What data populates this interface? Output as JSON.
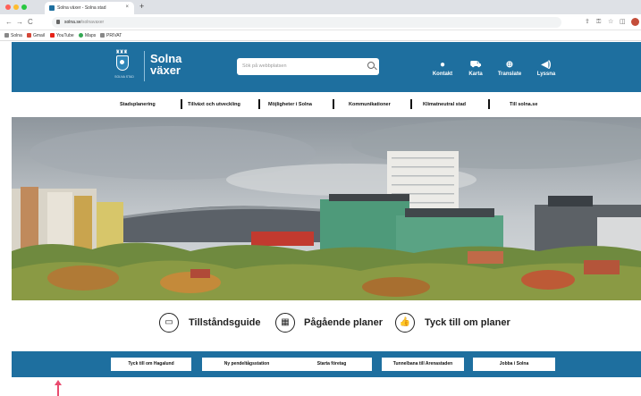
{
  "browser": {
    "tab_title": "Solna växer - Solna stad",
    "tab_close": "×",
    "new_tab": "+",
    "url_host": "solna.se",
    "url_path": "/solnavaxer",
    "nav_back": "←",
    "nav_forward": "→",
    "nav_reload": "C",
    "bookmarks": [
      "Solna",
      "Gmail",
      "YouTube",
      "Maps",
      "PRIVAT"
    ]
  },
  "header": {
    "logo_line1": "Solna",
    "logo_line2": "växer",
    "logo_sub": "SOLNA STAD",
    "search_placeholder": "Sök på webbplatsen",
    "buttons": [
      {
        "label": "Kontakt",
        "icon": "chat-icon"
      },
      {
        "label": "Karta",
        "icon": "map-icon"
      },
      {
        "label": "Translate",
        "icon": "globe-icon"
      },
      {
        "label": "Lyssna",
        "icon": "speaker-icon"
      }
    ]
  },
  "nav": {
    "items": [
      "Stadsplanering",
      "Tillväxt och utveckling",
      "Möjligheter i Solna",
      "Kommunikationer",
      "Klimatneutral stad",
      "Till solna.se"
    ]
  },
  "quick_links": [
    {
      "label": "Tillståndsguide",
      "icon": "monitor-icon"
    },
    {
      "label": "Pågående planer",
      "icon": "buildings-icon"
    },
    {
      "label": "Tyck till om planer",
      "icon": "thumbs-up-icon"
    }
  ],
  "shortcuts": [
    "Tyck till om Hagalund",
    "Ny pendeltågsstation",
    "Starta företag",
    "Tunnelbana till Arenastaden",
    "Jobba i Solna"
  ],
  "colors": {
    "brand": "#1e6f9f",
    "annotation_arrow": "#e94b6f"
  }
}
